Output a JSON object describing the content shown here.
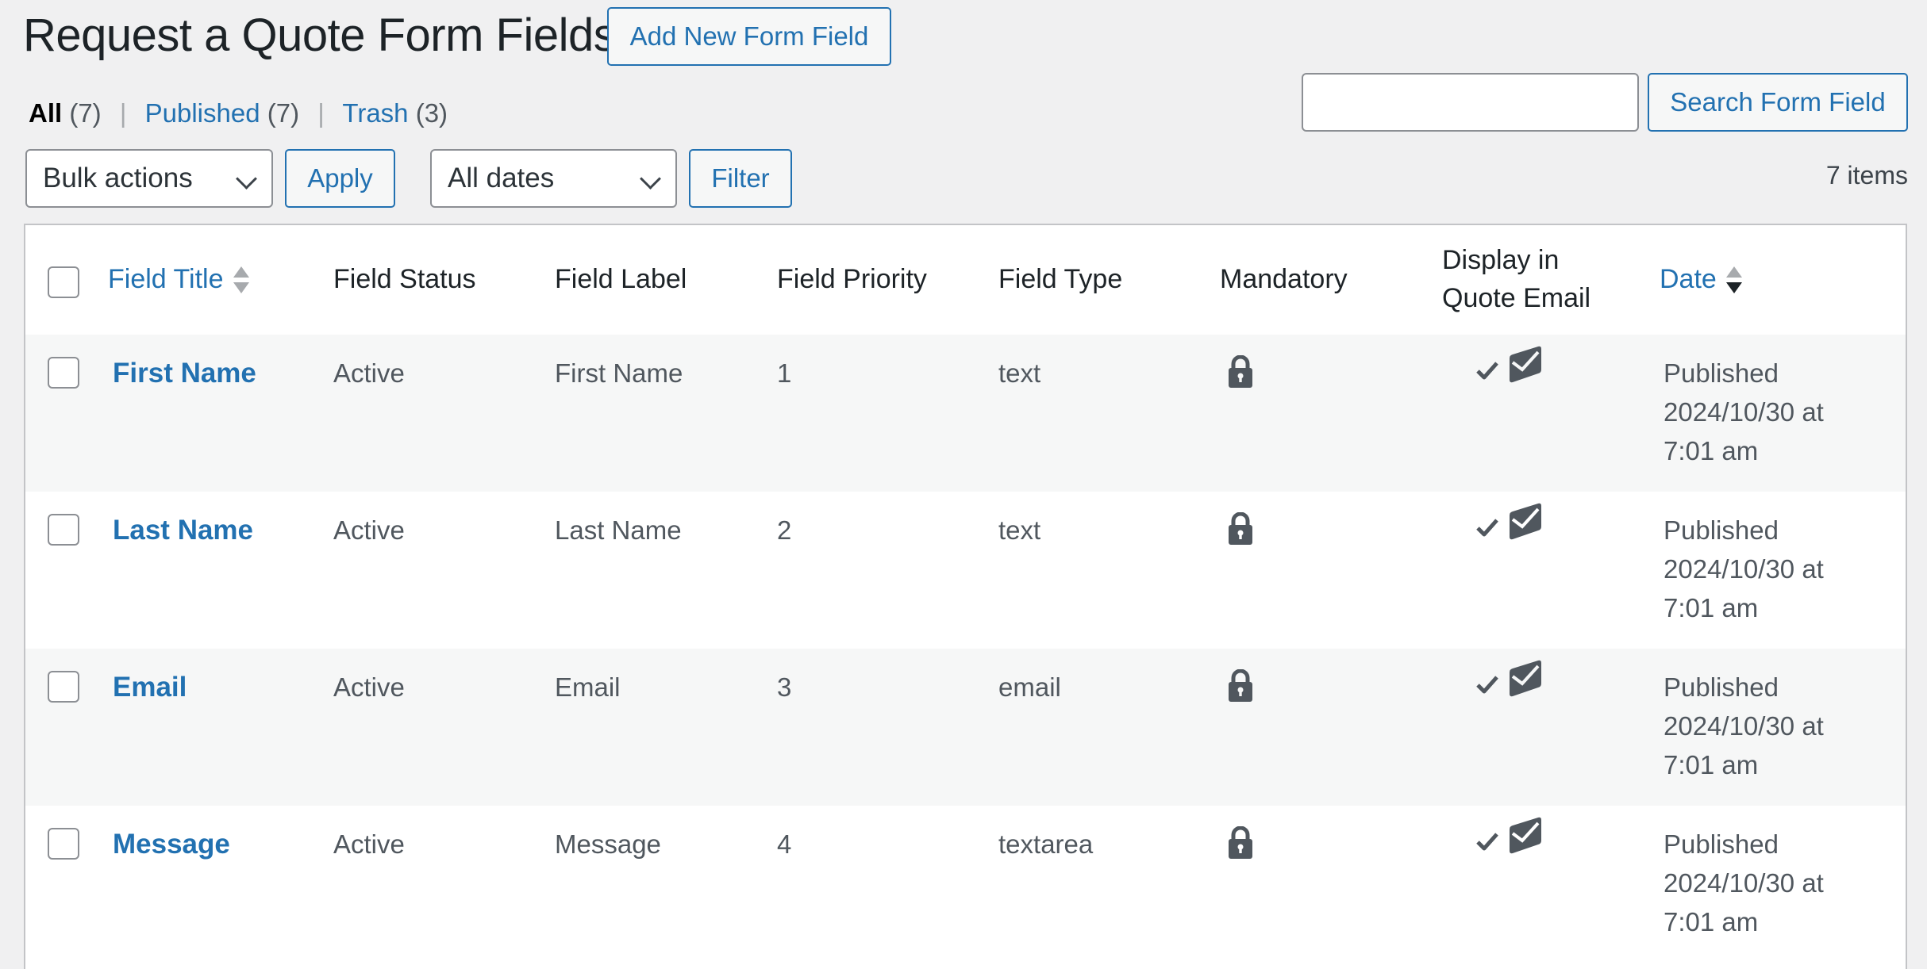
{
  "header": {
    "title": "Request a Quote Form Fields",
    "add_new_label": "Add New Form Field"
  },
  "views": [
    {
      "label": "All",
      "count": "(7)",
      "current": true
    },
    {
      "label": "Published",
      "count": "(7)",
      "current": false
    },
    {
      "label": "Trash",
      "count": "(3)",
      "current": false
    }
  ],
  "search": {
    "value": "",
    "placeholder": "",
    "button_label": "Search Form Field"
  },
  "tablenav": {
    "bulk_actions_selected": "Bulk actions",
    "apply_label": "Apply",
    "dates_selected": "All dates",
    "filter_label": "Filter",
    "items_count": "7 items"
  },
  "table": {
    "columns": [
      {
        "label": "Field Title",
        "sortable": true,
        "sort_state": "none"
      },
      {
        "label": "Field Status",
        "sortable": false
      },
      {
        "label": "Field Label",
        "sortable": false
      },
      {
        "label": "Field Priority",
        "sortable": false
      },
      {
        "label": "Field Type",
        "sortable": false
      },
      {
        "label": "Mandatory",
        "sortable": false
      },
      {
        "label": "Display in Quote Email",
        "line1": "Display in",
        "line2": "Quote Email",
        "sortable": false
      },
      {
        "label": "Date",
        "sortable": true,
        "sort_state": "desc"
      }
    ],
    "rows": [
      {
        "title": "First Name",
        "status": "Active",
        "label": "First Name",
        "priority": "1",
        "type": "text",
        "mandatory_icon": "lock-icon",
        "display_icons": [
          "checkmark-icon",
          "email-check-icon"
        ],
        "date_status": "Published",
        "date_line": "2024/10/30 at",
        "time": "7:01 am"
      },
      {
        "title": "Last Name",
        "status": "Active",
        "label": "Last Name",
        "priority": "2",
        "type": "text",
        "mandatory_icon": "lock-icon",
        "display_icons": [
          "checkmark-icon",
          "email-check-icon"
        ],
        "date_status": "Published",
        "date_line": "2024/10/30 at",
        "time": "7:01 am"
      },
      {
        "title": "Email",
        "status": "Active",
        "label": "Email",
        "priority": "3",
        "type": "email",
        "mandatory_icon": "lock-icon",
        "display_icons": [
          "checkmark-icon",
          "email-check-icon"
        ],
        "date_status": "Published",
        "date_line": "2024/10/30 at",
        "time": "7:01 am"
      },
      {
        "title": "Message",
        "status": "Active",
        "label": "Message",
        "priority": "4",
        "type": "textarea",
        "mandatory_icon": "lock-icon",
        "display_icons": [
          "checkmark-icon",
          "email-check-icon"
        ],
        "date_status": "Published",
        "date_line": "2024/10/30 at",
        "time": "7:01 am"
      }
    ]
  },
  "colors": {
    "accent": "#2271b1",
    "background": "#f0f0f1",
    "text": "#1d2327",
    "muted_text": "#50575e",
    "icon": "#50575e",
    "alt_row": "#f6f7f7",
    "border": "#c3c4c7"
  }
}
